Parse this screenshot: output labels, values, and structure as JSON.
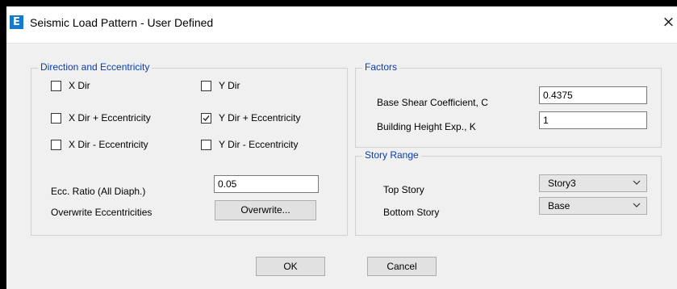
{
  "window": {
    "title": "Seismic Load Pattern - User Defined",
    "icon_letter": "E",
    "close_glyph": "×"
  },
  "direction_group": {
    "legend": "Direction and Eccentricity",
    "checkboxes": [
      {
        "label": "X Dir",
        "checked": false
      },
      {
        "label": "Y Dir",
        "checked": false
      },
      {
        "label": "X Dir + Eccentricity",
        "checked": false
      },
      {
        "label": "Y Dir + Eccentricity",
        "checked": true
      },
      {
        "label": "X Dir - Eccentricity",
        "checked": false
      },
      {
        "label": "Y Dir - Eccentricity",
        "checked": false
      }
    ],
    "ecc_ratio_label": "Ecc. Ratio (All Diaph.)",
    "ecc_ratio_value": "0.05",
    "overwrite_label": "Overwrite Eccentricities",
    "overwrite_button": "Overwrite..."
  },
  "factors_group": {
    "legend": "Factors",
    "base_shear_label": "Base Shear Coefficient, C",
    "base_shear_value": "0.4375",
    "height_exp_label": "Building Height Exp., K",
    "height_exp_value": "1"
  },
  "story_group": {
    "legend": "Story Range",
    "top_label": "Top Story",
    "top_value": "Story3",
    "bottom_label": "Bottom Story",
    "bottom_value": "Base"
  },
  "buttons": {
    "ok": "OK",
    "cancel": "Cancel"
  }
}
